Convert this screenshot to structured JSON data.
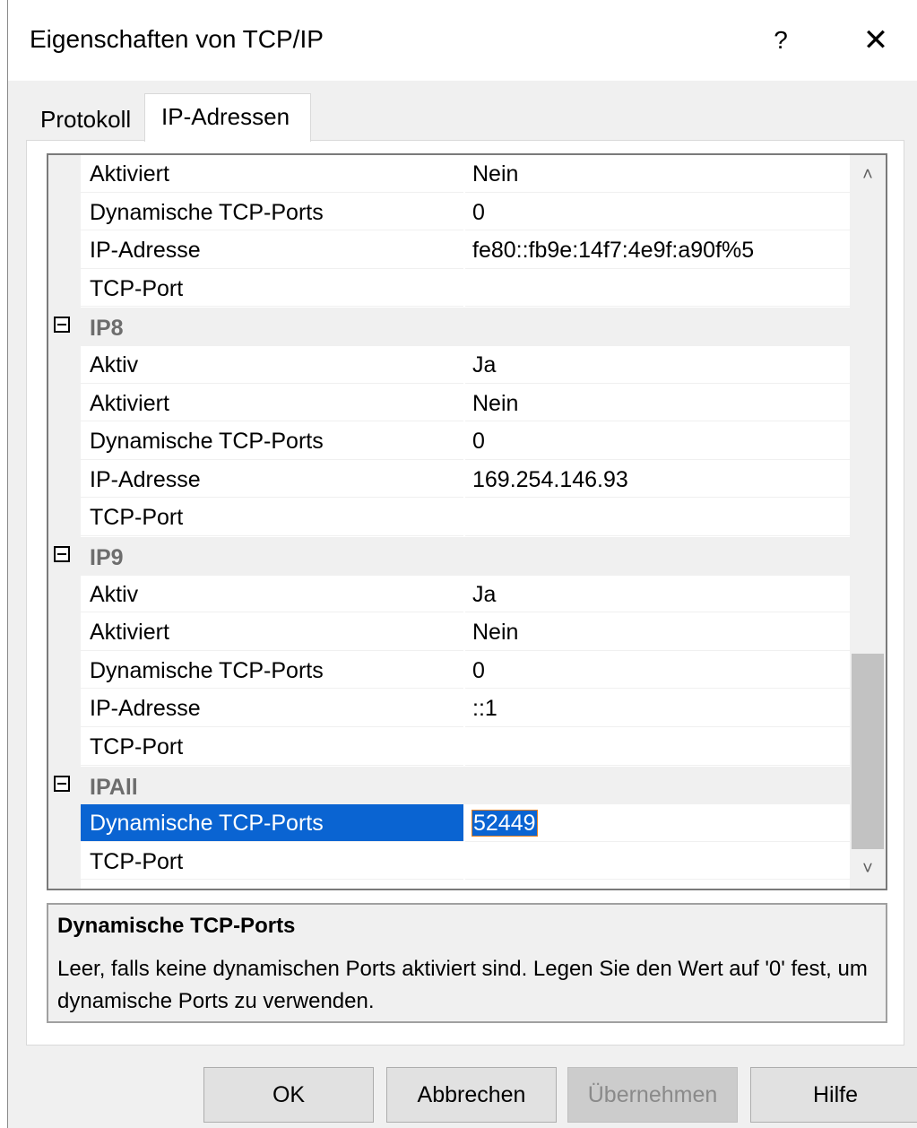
{
  "window": {
    "title": "Eigenschaften von TCP/IP",
    "help_glyph": "?",
    "close_glyph": "✕"
  },
  "tabs": [
    {
      "label": "Protokoll"
    },
    {
      "label": "IP-Adressen"
    }
  ],
  "grid": {
    "rows": [
      {
        "name": "Aktiviert",
        "value": "Nein"
      },
      {
        "name": "Dynamische TCP-Ports",
        "value": "0"
      },
      {
        "name": "IP-Adresse",
        "value": "fe80::fb9e:14f7:4e9f:a90f%5"
      },
      {
        "name": "TCP-Port",
        "value": ""
      },
      {
        "category": "IP8"
      },
      {
        "name": "Aktiv",
        "value": "Ja"
      },
      {
        "name": "Aktiviert",
        "value": "Nein"
      },
      {
        "name": "Dynamische TCP-Ports",
        "value": "0"
      },
      {
        "name": "IP-Adresse",
        "value": "169.254.146.93"
      },
      {
        "name": "TCP-Port",
        "value": ""
      },
      {
        "category": "IP9"
      },
      {
        "name": "Aktiv",
        "value": "Ja"
      },
      {
        "name": "Aktiviert",
        "value": "Nein"
      },
      {
        "name": "Dynamische TCP-Ports",
        "value": "0"
      },
      {
        "name": "IP-Adresse",
        "value": "::1"
      },
      {
        "name": "TCP-Port",
        "value": ""
      },
      {
        "category": "IPAll"
      },
      {
        "name": "Dynamische TCP-Ports",
        "value": "52449",
        "selected": true
      },
      {
        "name": "TCP-Port",
        "value": ""
      }
    ]
  },
  "scrollbar": {
    "up_glyph": "˄",
    "down_glyph": "˅"
  },
  "description": {
    "title": "Dynamische TCP-Ports",
    "text": "Leer, falls keine dynamischen Ports aktiviert sind. Legen Sie den Wert auf '0' fest, um dynamische Ports zu verwenden."
  },
  "buttons": {
    "ok": "OK",
    "cancel": "Abbrechen",
    "apply": "Übernehmen",
    "help": "Hilfe"
  }
}
